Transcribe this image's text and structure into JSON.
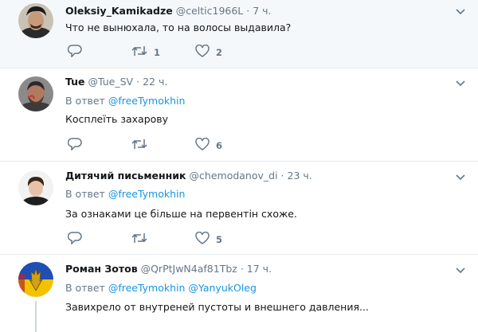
{
  "tweets": [
    {
      "name": "Oleksiy_Kamikadze",
      "handle": "@celtic1966L",
      "dot": "·",
      "time": "7 ч.",
      "text": "Что не вынюхала, то на волосы выдавила?",
      "actions": {
        "retweets": "1",
        "likes": "2",
        "replies": ""
      }
    },
    {
      "name": "Tue",
      "handle": "@Tue_SV",
      "dot": "·",
      "time": "22 ч.",
      "reply_prefix": "В ответ",
      "reply_links": [
        "@freeTymokhin"
      ],
      "text": "Косплеїть захарову",
      "actions": {
        "retweets": "",
        "likes": "6",
        "replies": ""
      }
    },
    {
      "name": "Дитячий письменник",
      "handle": "@chemodanov_di",
      "dot": "·",
      "time": "23 ч.",
      "reply_prefix": "В ответ",
      "reply_links": [
        "@freeTymokhin"
      ],
      "text": "За ознаками це більше на первентін схоже.",
      "actions": {
        "retweets": "",
        "likes": "5",
        "replies": ""
      }
    },
    {
      "name": "Роман Зотов",
      "handle": "@QrPtJwN4af81Tbz",
      "dot": "·",
      "time": "17 ч.",
      "reply_prefix": "В ответ",
      "reply_links": [
        "@freeTymokhin",
        "@YanyukOleg"
      ],
      "text": "Завихрело от внутреней пустоты и внешнего давления..."
    }
  ],
  "icons": {
    "reply": "reply-icon",
    "retweet": "retweet-icon",
    "like": "heart-icon",
    "caret": "chevron-down-icon"
  },
  "colors": {
    "link": "#1b95e0",
    "muted": "#657786",
    "text": "#14171a",
    "highlight_bg": "#f5f8fa"
  }
}
